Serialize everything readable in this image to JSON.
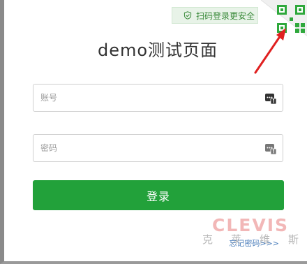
{
  "scan_tip": {
    "label": "扫码登录更安全",
    "icon": "shield-check-icon"
  },
  "corner": {
    "icon": "qr-code-icon",
    "annotation": "red-arrow"
  },
  "page": {
    "title": "demo测试页面"
  },
  "fields": {
    "account": {
      "placeholder": "账号",
      "icon": "password-keypad-icon"
    },
    "password": {
      "placeholder": "密码",
      "icon": "password-keypad-icon"
    }
  },
  "login": {
    "label": "登录"
  },
  "forgot": {
    "label": "忘记密码>>>"
  },
  "watermark": {
    "title": "CLEVIS",
    "chars": [
      "克",
      "莱",
      "维",
      "斯"
    ]
  },
  "colors": {
    "brand_green": "#22a13a",
    "tip_bg": "#e8f3e8",
    "arrow_red": "#e02020"
  }
}
